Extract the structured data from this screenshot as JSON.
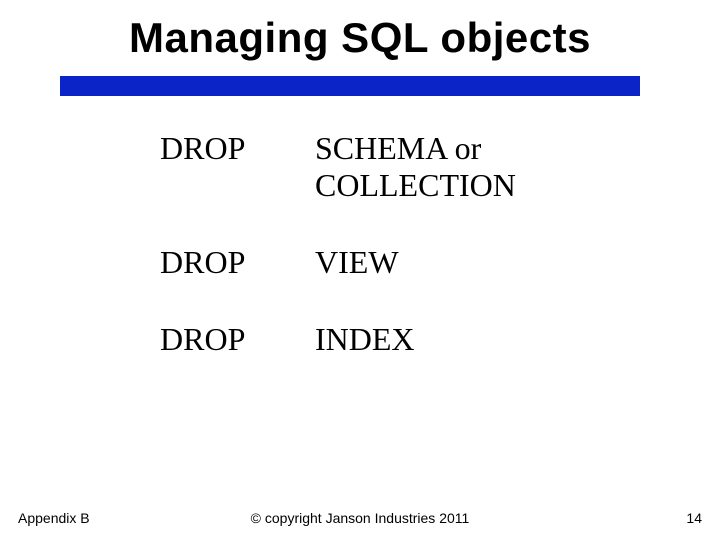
{
  "title": "Managing SQL objects",
  "rows": [
    {
      "command": "DROP",
      "object": "SCHEMA  or COLLECTION"
    },
    {
      "command": "DROP",
      "object": "VIEW"
    },
    {
      "command": "DROP",
      "object": "INDEX"
    }
  ],
  "footer": {
    "left": "Appendix B",
    "center": "© copyright Janson Industries 2011",
    "right": "14"
  },
  "colors": {
    "rule": "#0b24c8"
  }
}
